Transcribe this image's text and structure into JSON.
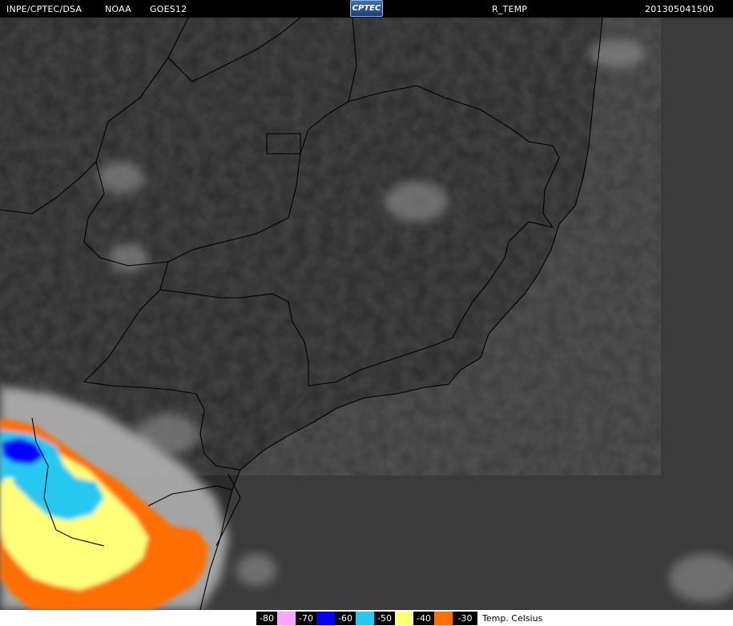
{
  "header": {
    "source": "INPE/CPTEC/DSA",
    "agency": "NOAA",
    "satellite": "GOES12",
    "logo_text": "CPTEC",
    "product": "R_TEMP",
    "timestamp": "201305041500"
  },
  "legend": {
    "unit": "Temp. Celsius",
    "entries": [
      {
        "value": "-80",
        "color": "#ffa5ff"
      },
      {
        "value": "-70",
        "color": "#0000ff"
      },
      {
        "value": "-60",
        "color": "#28c8f0"
      },
      {
        "value": "-50",
        "color": "#ffff78"
      },
      {
        "value": "-40",
        "color": "#ff6e00"
      },
      {
        "value": "-30",
        "color": ""
      }
    ]
  },
  "colors": {
    "land": "#2c2c2c",
    "ocean": "#3a3a3a",
    "border": "#000000",
    "cloud_cold_blue": "#0000ff",
    "cloud_cyan": "#28c8f0",
    "cloud_yellow": "#ffff78",
    "cloud_orange": "#ff6e00"
  }
}
